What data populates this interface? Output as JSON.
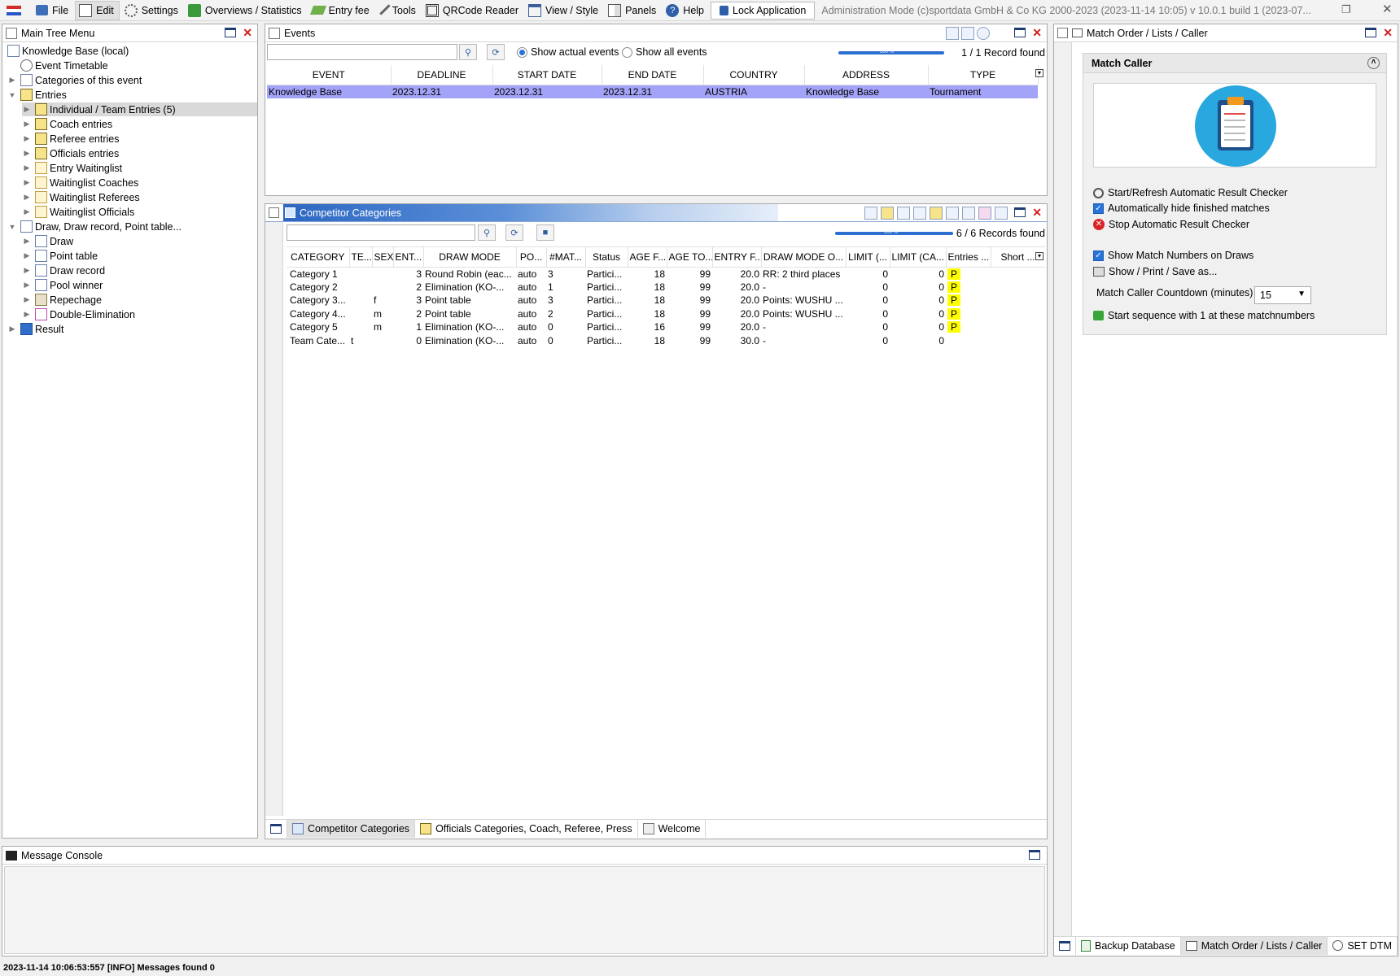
{
  "menu": {
    "items": [
      "File",
      "Edit",
      "Settings",
      "Overviews / Statistics",
      "Entry fee",
      "Tools",
      "QRCode Reader",
      "View / Style",
      "Panels",
      "Help"
    ],
    "lock": "Lock Application",
    "title": "Administration Mode (c)sportdata GmbH & Co KG 2000-2023 (2023-11-14 10:05)  v 10.0.1 build 1 (2023-07..."
  },
  "tree": {
    "title": "Main Tree Menu",
    "nodes": [
      {
        "label": "Knowledge Base (local)"
      },
      {
        "label": "Event Timetable"
      },
      {
        "label": "Categories of this event"
      },
      {
        "label": "Entries"
      },
      {
        "label": "Individual / Team Entries (5)"
      },
      {
        "label": "Coach entries"
      },
      {
        "label": "Referee entries"
      },
      {
        "label": "Officials entries"
      },
      {
        "label": "Entry Waitinglist"
      },
      {
        "label": "Waitinglist Coaches"
      },
      {
        "label": "Waitinglist Referees"
      },
      {
        "label": "Waitinglist Officials"
      },
      {
        "label": "Draw, Draw record, Point table..."
      },
      {
        "label": "Draw"
      },
      {
        "label": "Point table"
      },
      {
        "label": "Draw record"
      },
      {
        "label": "Pool winner"
      },
      {
        "label": "Repechage"
      },
      {
        "label": "Double-Elimination"
      },
      {
        "label": "Result"
      }
    ]
  },
  "events": {
    "title": "Events",
    "radio_actual": "Show actual events",
    "radio_all": "Show all events",
    "progress_label": "100 %",
    "progress": 1.0,
    "records": "1 / 1 Record found",
    "columns": [
      "EVENT",
      "DEADLINE",
      "START DATE",
      "END DATE",
      "COUNTRY",
      "ADDRESS",
      "TYPE"
    ],
    "rows": [
      [
        "Knowledge Base",
        "2023.12.31",
        "2023.12.31",
        "2023.12.31",
        "AUSTRIA",
        "Knowledge Base",
        "Tournament"
      ]
    ]
  },
  "categories": {
    "title": "Competitor Categories",
    "progress_label": "100 %",
    "progress": 1.0,
    "records": "6 / 6 Records found",
    "columns": [
      "CATEGORY",
      "TE...",
      "SEX",
      "ENT...",
      "DRAW MODE",
      "PO...",
      "#MAT...",
      "Status",
      "AGE F...",
      "AGE TO...",
      "ENTRY F...",
      "DRAW MODE O...",
      "LIMIT (...",
      "LIMIT (CA...",
      "Entries ...",
      "Short ..."
    ],
    "rows": [
      [
        "Category 1",
        "",
        "",
        "3",
        "Round Robin (eac...",
        "auto",
        "3",
        "Partici...",
        "18",
        "99",
        "20.0",
        "RR: 2 third places",
        "0",
        "0",
        "P",
        ""
      ],
      [
        "Category 2",
        "",
        "",
        "2",
        "Elimination (KO-...",
        "auto",
        "1",
        "Partici...",
        "18",
        "99",
        "20.0",
        "-",
        "0",
        "0",
        "P",
        ""
      ],
      [
        "Category 3...",
        "",
        "f",
        "3",
        "Point table",
        "auto",
        "3",
        "Partici...",
        "18",
        "99",
        "20.0",
        "Points: WUSHU ...",
        "0",
        "0",
        "P",
        ""
      ],
      [
        "Category 4...",
        "",
        "m",
        "2",
        "Point table",
        "auto",
        "2",
        "Partici...",
        "18",
        "99",
        "20.0",
        "Points: WUSHU ...",
        "0",
        "0",
        "P",
        ""
      ],
      [
        "Category 5",
        "",
        "m",
        "1",
        "Elimination (KO-...",
        "auto",
        "0",
        "Partici...",
        "16",
        "99",
        "20.0",
        "-",
        "0",
        "0",
        "P",
        ""
      ],
      [
        "Team Cate...",
        "t",
        "",
        "0",
        "Elimination (KO-...",
        "auto",
        "0",
        "Partici...",
        "18",
        "99",
        "30.0",
        "-",
        "0",
        "0",
        "",
        ""
      ]
    ],
    "tabs": [
      "Competitor Categories",
      "Officials Categories, Coach, Referee, Press",
      "Welcome"
    ]
  },
  "console": {
    "title": "Message Console"
  },
  "right": {
    "title": "Match Order / Lists / Caller",
    "section": "Match Caller",
    "start_refresh": "Start/Refresh Automatic Result Checker",
    "auto_hide": "Automatically hide finished matches",
    "stop_checker": "Stop Automatic Result Checker",
    "show_numbers": "Show Match Numbers on Draws",
    "show_print": "Show / Print / Save as...",
    "countdown_label": "Match Caller Countdown (minutes)",
    "countdown_value": "15",
    "start_sequence": "Start sequence with 1 at these matchnumbers",
    "tabs": [
      "Backup Database",
      "Match Order / Lists / Caller",
      "SET DTM"
    ]
  },
  "status": "2023-11-14 10:06:53:557 [INFO] Messages found 0",
  "colors": {
    "selected_row": "#a3a3f7",
    "badge": "#ffff00",
    "accent": "#2673d9"
  }
}
